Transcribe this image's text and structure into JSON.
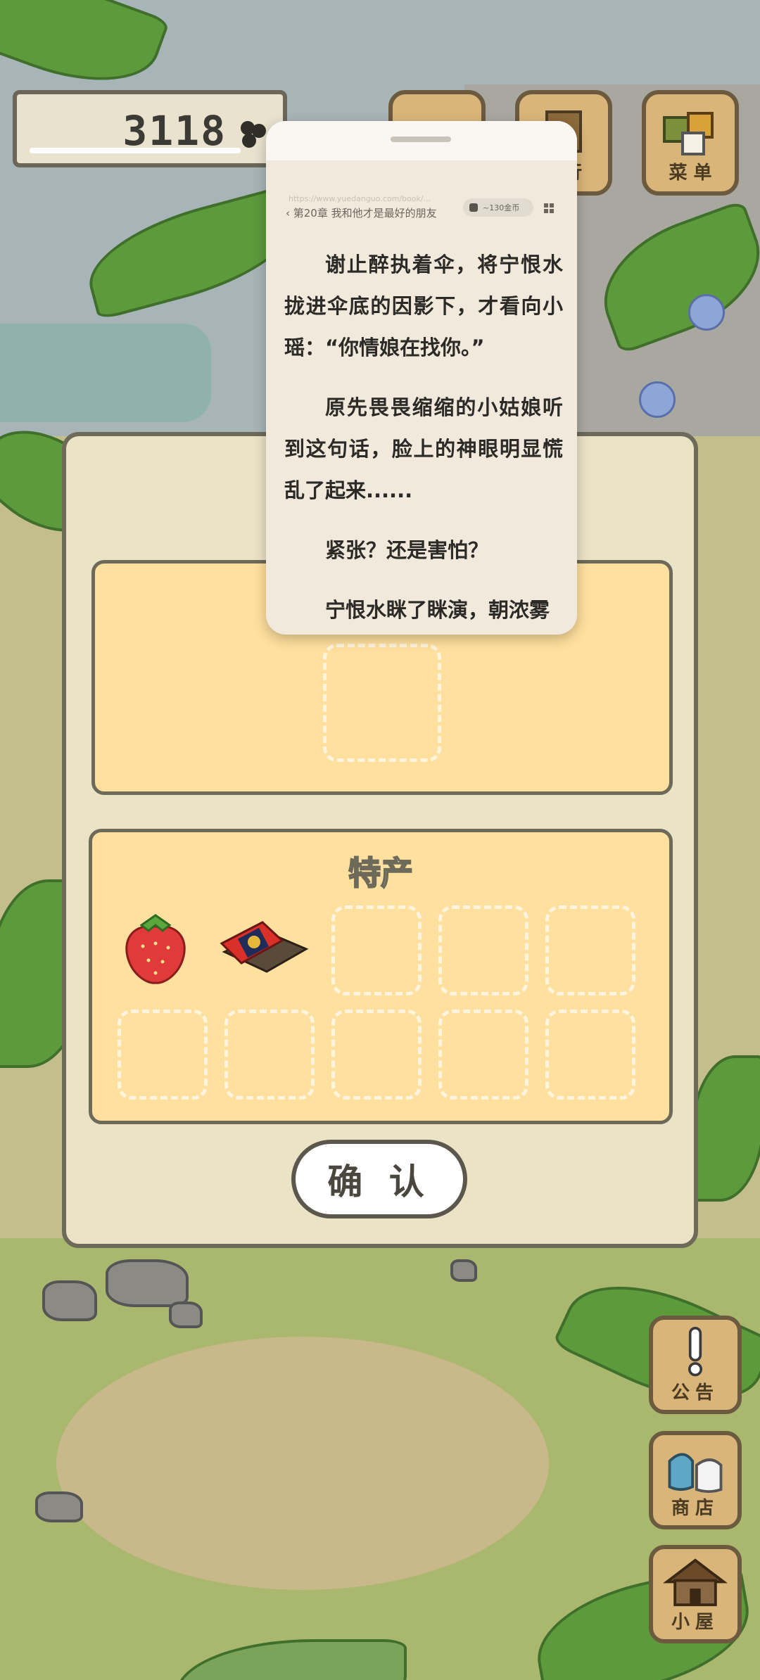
{
  "coins": {
    "value": "3118",
    "icon": "clover-icon"
  },
  "top_buttons": [
    {
      "label": "",
      "icon": "album-icon"
    },
    {
      "label": "旅行",
      "icon": "travel-icon"
    },
    {
      "label": "菜 单",
      "icon": "menu-icon"
    }
  ],
  "side_buttons": [
    {
      "label": "公告",
      "icon": "exclamation-icon"
    },
    {
      "label": "商店",
      "icon": "bag-icon"
    },
    {
      "label": "小屋",
      "icon": "house-icon"
    }
  ],
  "panel": {
    "specialty_title": "特产",
    "items": [
      {
        "name": "草莓",
        "icon": "strawberry-icon"
      },
      {
        "name": "礼盒",
        "icon": "gift-box-icon"
      }
    ],
    "confirm_label": "确 认"
  },
  "reader": {
    "url": "https://www.yuedanguo.com/book/...",
    "chapter": "‹ 第20章 我和他才是最好的朋友",
    "coin_pill": "~130金币",
    "paragraphs": [
      "谢止醉执着伞，将宁恨水拢进伞底的因影下，才看向小瑶：“你情娘在找你。”",
      "原先畏畏缩缩的小姑娘听到这句话，脸上的神眼明显慌乱了起来......",
      "紧张？还是害怕？",
      "宁恨水眯了眯演，朝浓雾"
    ]
  }
}
